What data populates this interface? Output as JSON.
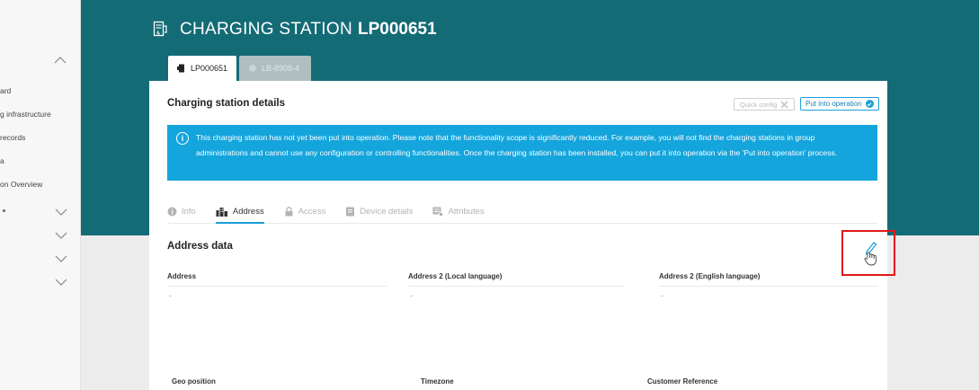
{
  "sidebar": {
    "items": [
      {
        "label": "ard"
      },
      {
        "label": "g infrastructure"
      },
      {
        "label": "records"
      },
      {
        "label": "a"
      },
      {
        "label": "on Overview"
      }
    ]
  },
  "header": {
    "title_prefix": "CHARGING STATION",
    "title_id": "LP000651"
  },
  "top_tabs": [
    {
      "label": "LP000651"
    },
    {
      "label": "LB-8908-4"
    }
  ],
  "card": {
    "title": "Charging station details",
    "quick_config_label": "Quick config",
    "put_into_operation_label": "Put into operation",
    "banner_text": "This charging station has not yet been put into operation. Please note that the functionality scope is significantly reduced. For example, you will not find the charging stations in group administrations and cannot use any configuration or controlling functionalities. Once the charging station has been installed, you can put it into operation via the 'Put into operation' process."
  },
  "sub_tabs": [
    {
      "label": "Info"
    },
    {
      "label": "Address"
    },
    {
      "label": "Access"
    },
    {
      "label": "Device details"
    },
    {
      "label": "Attributes"
    }
  ],
  "address_section": {
    "title": "Address data",
    "fields": [
      {
        "label": "Address",
        "value": "-"
      },
      {
        "label": "Address 2 (Local language)",
        "value": "-"
      },
      {
        "label": "Address 2 (English language)",
        "value": "-"
      }
    ],
    "fields_row2": [
      {
        "label": "Geo position"
      },
      {
        "label": "Timezone"
      },
      {
        "label": "Customer Reference"
      }
    ]
  },
  "colors": {
    "header_teal": "#136b76",
    "accent_blue": "#14a5dc",
    "highlight_red": "#e0191b"
  },
  "icons": [
    "charging-station-icon",
    "info-icon",
    "address-icon",
    "lock-icon",
    "device-icon",
    "attributes-icon",
    "edit-pencil-icon",
    "hand-cursor-icon",
    "chevron-up-icon",
    "chevron-down-icon"
  ]
}
